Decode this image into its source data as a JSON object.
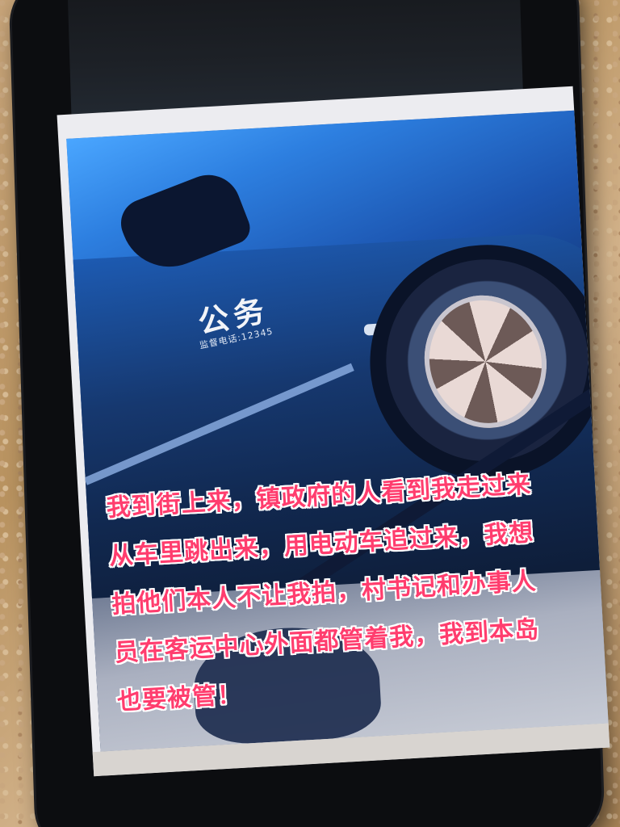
{
  "photo": {
    "door_label": "公务",
    "door_sublabel": "监督电话:12345"
  },
  "caption": {
    "lines": [
      "我到街上来，镇政府的人看到我走过来",
      "从车里跳出来，用电动车追过来，我想",
      "拍他们本人不让我拍，村书记和办事人",
      "员在客运中心外面都管着我，我到本岛",
      "也要被管！"
    ]
  },
  "colors": {
    "caption_text": "#ff3d6e",
    "caption_outline": "#ffffff",
    "car": "#16386f",
    "background_counter": "#c8a57a"
  }
}
